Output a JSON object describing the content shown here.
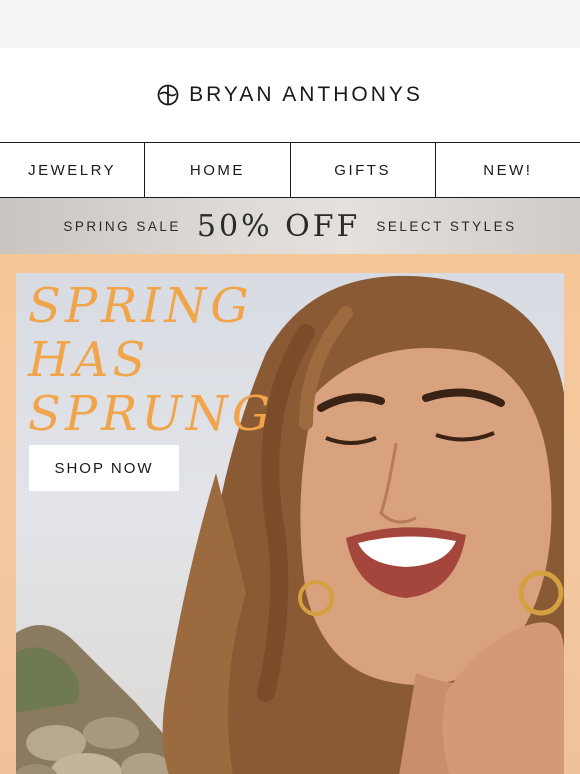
{
  "header": {
    "brand_name": "BRYAN ANTHONYS",
    "logo_icon": "compass-circle-icon"
  },
  "nav": {
    "items": [
      {
        "label": "JEWELRY"
      },
      {
        "label": "HOME"
      },
      {
        "label": "GIFTS"
      },
      {
        "label": "NEW!"
      }
    ]
  },
  "promo": {
    "prefix": "SPRING SALE",
    "highlight": "50% OFF",
    "suffix": "SELECT STYLES"
  },
  "hero": {
    "headline_lines": [
      "SPRING",
      "HAS",
      "SPRUNG"
    ],
    "cta_label": "SHOP NOW",
    "headline_color": "#f1a54a",
    "frame_color": "#f6c696"
  }
}
